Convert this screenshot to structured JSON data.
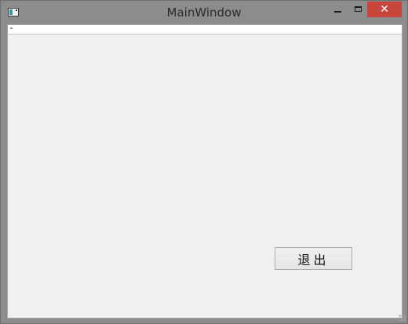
{
  "window": {
    "title": "MainWindow",
    "close_glyph": "✕"
  },
  "main": {
    "quit_button_label": "退出"
  },
  "icons": {
    "app": "app-window-icon",
    "minimize": "minimize-icon",
    "maximize": "maximize-icon",
    "close": "close-icon",
    "resize": "size-grip-icon"
  },
  "colors": {
    "titlebar": "#8c8c8c",
    "close_button": "#c7453d",
    "client_background": "#f0f0f0"
  }
}
